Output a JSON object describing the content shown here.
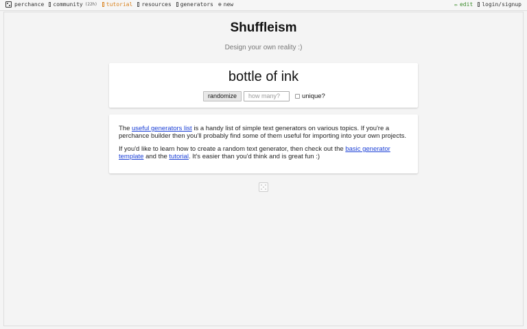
{
  "nav": {
    "left": [
      {
        "label": "perchance",
        "icon": "dice-icon"
      },
      {
        "label": "community",
        "icon": "chat-icon",
        "badge": "(22h)"
      },
      {
        "label": "tutorial",
        "icon": "book-icon",
        "color": "#d9831f"
      },
      {
        "label": "resources",
        "icon": "bookmark-icon"
      },
      {
        "label": "generators",
        "icon": "list-icon"
      },
      {
        "label": "new",
        "icon": "plus-circle-icon"
      }
    ],
    "edit_label": "edit",
    "login_label": "login/signup",
    "edit_color": "#3a8a2a"
  },
  "page": {
    "title": "Shuffleism",
    "subtitle": "Design your own reality :)"
  },
  "generator": {
    "output": "bottle of ink",
    "randomize_label": "randomize",
    "count_placeholder": "how many?",
    "unique_label": "unique?",
    "unique_checked": false
  },
  "info": {
    "p1_pre": "The ",
    "p1_link": "useful generators list",
    "p1_post": " is a handy list of simple text generators on various topics. If you're a perchance builder then you'll probably find some of them useful for importing into your own projects.",
    "p2_pre": "If you'd like to learn how to create a random text generator, then check out the ",
    "p2_link1": "basic generator template",
    "p2_mid": " and the ",
    "p2_link2": "tutorial",
    "p2_post": ". It's easier than you'd think and is great fun :)",
    "link_color": "#1a3fd6"
  }
}
